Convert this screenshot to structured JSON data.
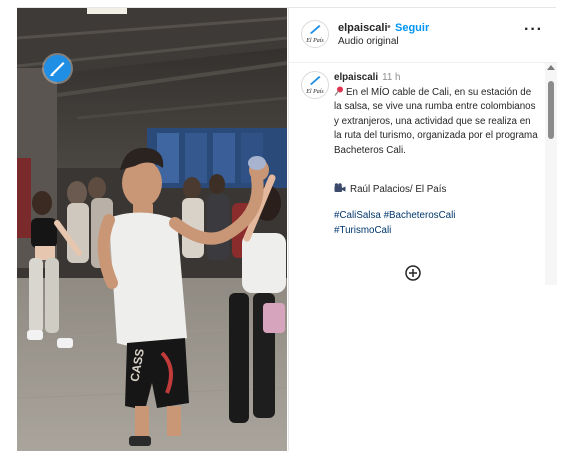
{
  "post": {
    "username": "elpaiscali",
    "follow_label": "Seguir",
    "separator": "•",
    "audio_label": "Audio original",
    "more_label": "···",
    "brand_logo_text": "El País"
  },
  "caption": {
    "username": "elpaiscali",
    "time": "11 h",
    "pin_icon": "pushpin-icon",
    "text": "En el MÍO cable de Cali, en su estación de la salsa, se vive una rumba entre colombianos y extranjeros, una actividad que se realiza en la ruta del turismo, organizada por el programa Bacheteros Cali.",
    "credit_icon": "movie-camera-icon",
    "credit": "Raúl Palacios/ El País",
    "hashtags": [
      "#CaliSalsa",
      "#BacheterosCali",
      "#TurismoCali"
    ]
  },
  "media": {
    "badge_icon": "el-pais-badge-icon",
    "shorts_text": "CASS"
  },
  "colors": {
    "accent": "#0095f6",
    "hashtag": "#00376b",
    "badge": "#1f8fe5"
  }
}
